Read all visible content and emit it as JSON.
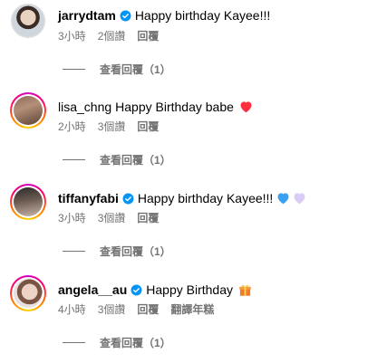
{
  "colors": {
    "verified": "#0095f6",
    "meta": "#737373",
    "heart": "#ff3040",
    "blue_heart": "#3aa0f2",
    "lavender_heart": "#d9ccf5"
  },
  "comments": [
    {
      "username": "jarrydtam",
      "verified": true,
      "text": "Happy birthday Kayee!!!",
      "time": "3小時",
      "likes": "2個讚",
      "reply": "回覆",
      "view_replies": "查看回覆（1）",
      "emoji": []
    },
    {
      "username": "lisa_chng",
      "verified": false,
      "text": "Happy Birthday babe",
      "time": "2小時",
      "likes": "3個讚",
      "reply": "回覆",
      "view_replies": "查看回覆（1）",
      "emoji": [
        "red-heart"
      ]
    },
    {
      "username": "tiffanyfabi",
      "verified": true,
      "text": "Happy birthday Kayee!!!",
      "time": "3小時",
      "likes": "3個讚",
      "reply": "回覆",
      "view_replies": "查看回覆（1）",
      "emoji": [
        "blue-heart",
        "lavender-heart"
      ]
    },
    {
      "username": "angela__au",
      "verified": true,
      "text": "Happy Birthday",
      "time": "4小時",
      "likes": "3個讚",
      "reply": "回覆",
      "translate": "翻譯年糕",
      "view_replies": "查看回覆（1）",
      "emoji": [
        "gift"
      ]
    }
  ]
}
